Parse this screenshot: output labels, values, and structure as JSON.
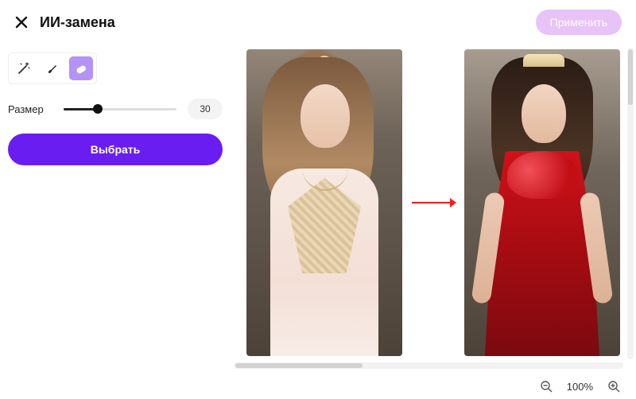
{
  "header": {
    "title": "ИИ-замена",
    "apply_label": "Применить"
  },
  "sidebar": {
    "tools": {
      "magic_name": "magic-select-tool",
      "brush_name": "brush-tool",
      "eraser_name": "eraser-tool"
    },
    "size_label": "Размер",
    "size_value": "30",
    "select_label": "Выбрать"
  },
  "zoom": {
    "level": "100%"
  }
}
